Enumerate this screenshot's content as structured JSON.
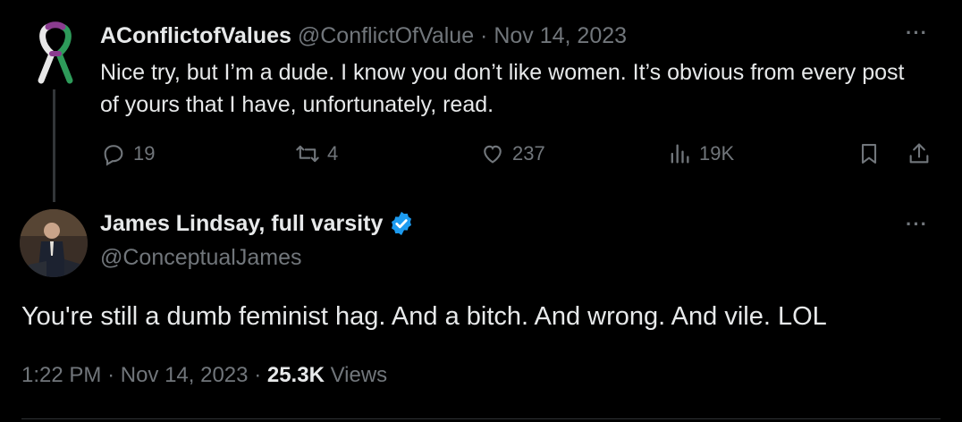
{
  "tweet1": {
    "name": "AConflictofValues",
    "handle": "@ConflictOfValue",
    "sep": "·",
    "date": "Nov 14, 2023",
    "text": "Nice try, but I’m a dude. I know you don’t like women. It’s obvious from every post of yours that I have, unfortunately, read.",
    "more": "···",
    "replies": "19",
    "reposts": "4",
    "likes": "237",
    "views": "19K",
    "avatar_icon": "awareness-ribbon-icon"
  },
  "tweet2": {
    "name": "James Lindsay, full varsity",
    "handle": "@ConceptualJames",
    "more": "···",
    "text": "You're still a dumb feminist hag. And a bitch. And wrong. And vile. LOL",
    "time": "1:22 PM",
    "sep1": "·",
    "date": "Nov 14, 2023",
    "sep2": "·",
    "views_count": "25.3K",
    "views_label": "Views",
    "badge_color": "#1d9bf0"
  },
  "colors": {
    "background": "#000000",
    "text": "#e7e9ea",
    "muted": "#71767b",
    "accent": "#1d9bf0"
  }
}
